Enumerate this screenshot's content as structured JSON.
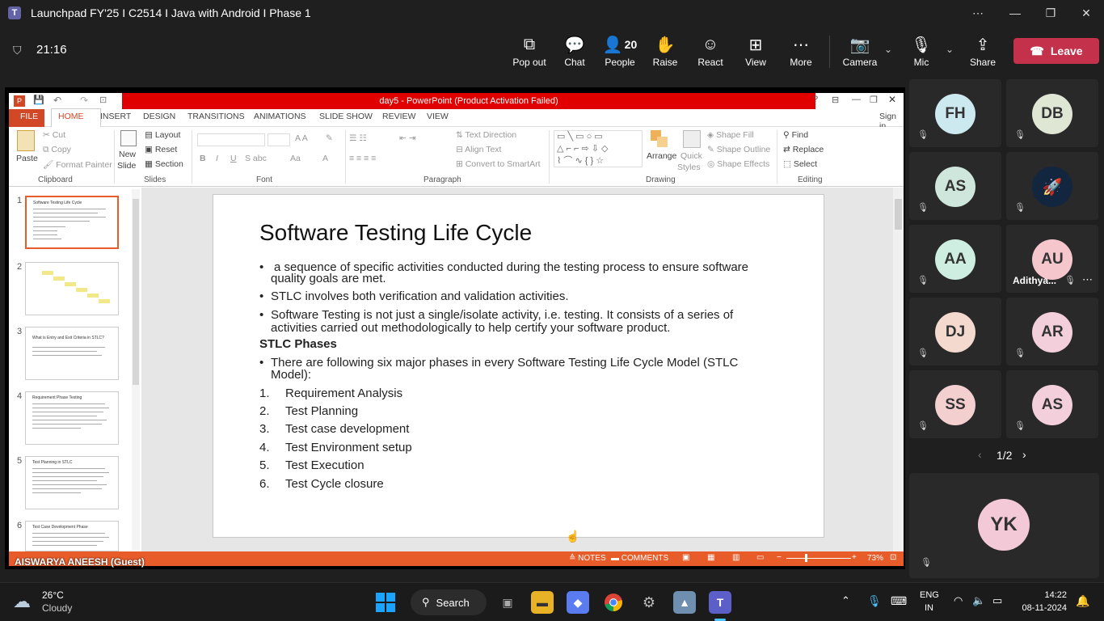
{
  "window": {
    "title": "Launchpad FY'25 I C2514 I Java with Android I Phase 1"
  },
  "meeting": {
    "timer": "21:16",
    "people_count": "20",
    "toolbar": [
      {
        "label": "Pop out",
        "icon": "pop-out-icon"
      },
      {
        "label": "Chat",
        "icon": "chat-icon"
      },
      {
        "label": "People",
        "icon": "people-icon"
      },
      {
        "label": "Raise",
        "icon": "raise-hand-icon"
      },
      {
        "label": "React",
        "icon": "react-icon"
      },
      {
        "label": "View",
        "icon": "view-icon"
      },
      {
        "label": "More",
        "icon": "more-icon"
      },
      {
        "label": "Camera",
        "icon": "camera-off-icon"
      },
      {
        "label": "Mic",
        "icon": "mic-off-icon"
      },
      {
        "label": "Share",
        "icon": "share-icon"
      }
    ],
    "leave_label": "Leave",
    "presenter_label": "AISWARYA ANEESH (Guest)",
    "page_indicator": "1/2"
  },
  "ppt": {
    "title": "day5 - PowerPoint (Product Activation Failed)",
    "tabs": [
      "FILE",
      "HOME",
      "INSERT",
      "DESIGN",
      "TRANSITIONS",
      "ANIMATIONS",
      "SLIDE SHOW",
      "REVIEW",
      "VIEW"
    ],
    "signin": "Sign in",
    "ribbon": {
      "paste": "Paste",
      "cut": "Cut",
      "copy": "Copy",
      "format_painter": "Format Painter",
      "new_slide": "New",
      "new_slide2": "Slide",
      "layout": "Layout",
      "reset": "Reset",
      "section": "Section",
      "text_direction": "Text Direction",
      "align_text": "Align Text",
      "smartart": "Convert to SmartArt",
      "arrange": "Arrange",
      "quick_styles": "Quick",
      "quick_styles2": "Styles",
      "shape_fill": "Shape Fill",
      "shape_outline": "Shape Outline",
      "shape_effects": "Shape Effects",
      "find": "Find",
      "replace": "Replace",
      "select": "Select",
      "groups": [
        "Clipboard",
        "Slides",
        "Font",
        "Paragraph",
        "Drawing",
        "Editing"
      ]
    },
    "thumbnail_numbers": [
      "1",
      "2",
      "3",
      "4",
      "5",
      "6"
    ],
    "thumbnail_titles": [
      "Software Testing Life Cycle",
      "",
      "What is Entry and Exit Criteria in STLC?",
      "Requirement Phase Testing",
      "Test Planning in STLC",
      "Test Case Development Phase"
    ],
    "status": {
      "notes": "NOTES",
      "comments": "COMMENTS",
      "zoom": "73%"
    },
    "slide": {
      "title": "Software Testing Life Cycle",
      "b1": "a sequence of specific activities conducted during the testing process to ensure software",
      "b1b": "quality goals are met.",
      "b2": "STLC involves both verification and validation activities.",
      "b3": "Software Testing is not just a single/isolate activity, i.e. testing. It consists of a series of",
      "b3b": "activities carried out methodologically to help certify your software product.",
      "heading": "STLC Phases",
      "b4": "There are following six major phases in every Software Testing Life Cycle Model (STLC",
      "b4b": "Model):",
      "phases": [
        "Requirement Analysis",
        "Test Planning",
        "Test case development",
        "Test Environment setup",
        "Test Execution",
        "Test Cycle closure"
      ],
      "phase_nums": [
        "1.",
        "2.",
        "3.",
        "4.",
        "5.",
        "6."
      ]
    }
  },
  "participants": [
    {
      "initials": "FH",
      "color": "#cde9f0"
    },
    {
      "initials": "DB",
      "color": "#dfe6d4"
    },
    {
      "initials": "AS",
      "color": "#cfe6dc"
    },
    {
      "initials": "",
      "color": "#13263f"
    },
    {
      "initials": "AA",
      "color": "#cdeee0"
    },
    {
      "initials": "AU",
      "color": "#f5c6cc",
      "name": "Adithya..."
    },
    {
      "initials": "DJ",
      "color": "#f4d9cf"
    },
    {
      "initials": "AR",
      "color": "#f3cfdc"
    },
    {
      "initials": "SS",
      "color": "#f3cfcf"
    },
    {
      "initials": "AS",
      "color": "#f3cfdc"
    },
    {
      "initials": "YK",
      "color": "#f3c9d8"
    }
  ],
  "taskbar": {
    "weather_temp": "26°C",
    "weather_desc": "Cloudy",
    "search": "Search",
    "lang1": "ENG",
    "lang2": "IN",
    "time": "14:22",
    "date": "08-11-2024"
  }
}
